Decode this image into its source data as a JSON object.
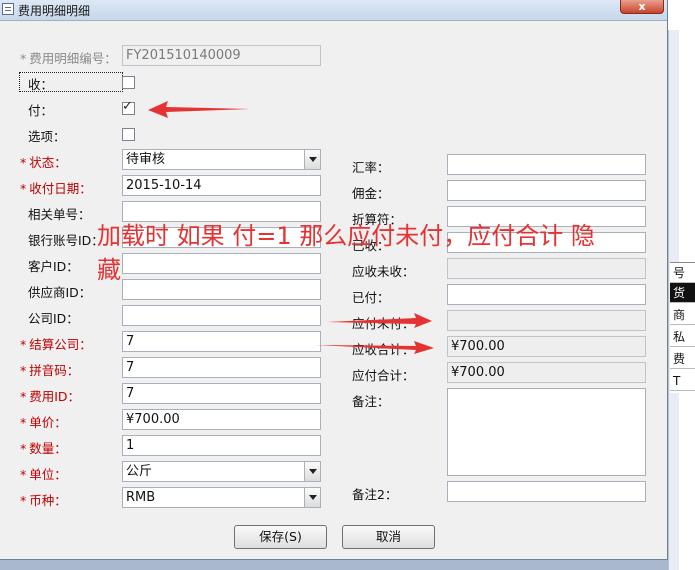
{
  "window": {
    "title": "费用明细明细",
    "close_glyph": "x"
  },
  "fields_left": {
    "detail_no": {
      "label": "费用明细编号：",
      "value": "FY201510140009"
    },
    "receive": {
      "label": "收："
    },
    "pay": {
      "label": "付："
    },
    "option": {
      "label": "选项："
    },
    "status": {
      "label": "状态：",
      "value": "待审核"
    },
    "date": {
      "label": "收付日期：",
      "value": "2015-10-14"
    },
    "related_no": {
      "label": "相关单号：",
      "value": ""
    },
    "bank_account": {
      "label": "银行账号ID：",
      "value": ""
    },
    "customer_id": {
      "label": "客户ID：",
      "value": ""
    },
    "supplier_id": {
      "label": "供应商ID：",
      "value": ""
    },
    "company_id": {
      "label": "公司ID：",
      "value": ""
    },
    "settle_company": {
      "label": "结算公司：",
      "value": "7"
    },
    "pinyin": {
      "label": "拼音码：",
      "value": "7"
    },
    "fee_id": {
      "label": "费用ID：",
      "value": "7"
    },
    "unit_price": {
      "label": "单价：",
      "value": "¥700.00"
    },
    "quantity": {
      "label": "数量：",
      "value": "1"
    },
    "unit": {
      "label": "单位：",
      "value": "公斤"
    },
    "currency": {
      "label": "币种：",
      "value": "RMB"
    }
  },
  "fields_right": {
    "rate": {
      "label": "汇率：",
      "value": ""
    },
    "commission": {
      "label": "佣金：",
      "value": ""
    },
    "discount": {
      "label": "折算符：",
      "value": ""
    },
    "received": {
      "label": "已收：",
      "value": ""
    },
    "receivable_unpaid": {
      "label": "应收未收：",
      "value": ""
    },
    "paid": {
      "label": "已付：",
      "value": ""
    },
    "payable_unpaid": {
      "label": "应付未付：",
      "value": ""
    },
    "receivable_total": {
      "label": "应收合计：",
      "value": "¥700.00"
    },
    "payable_total": {
      "label": "应付合计：",
      "value": "¥700.00"
    },
    "remark": {
      "label": "备注：",
      "value": ""
    },
    "remark2": {
      "label": "备注2：",
      "value": ""
    }
  },
  "checkboxes": {
    "receive": false,
    "pay": true,
    "option": false
  },
  "buttons": {
    "save": "保存(S)",
    "cancel": "取消"
  },
  "annotation": {
    "line1": "加载时 如果 付=1 那么应付未付，应付合计 隐",
    "line2": "藏"
  },
  "background_grid": {
    "cells": [
      "号",
      "货",
      "商",
      "私",
      "费",
      "T"
    ]
  },
  "colors": {
    "annotation_red": "#e53232",
    "required_red": "#c00000",
    "titlebar": "#c7d7ea"
  }
}
